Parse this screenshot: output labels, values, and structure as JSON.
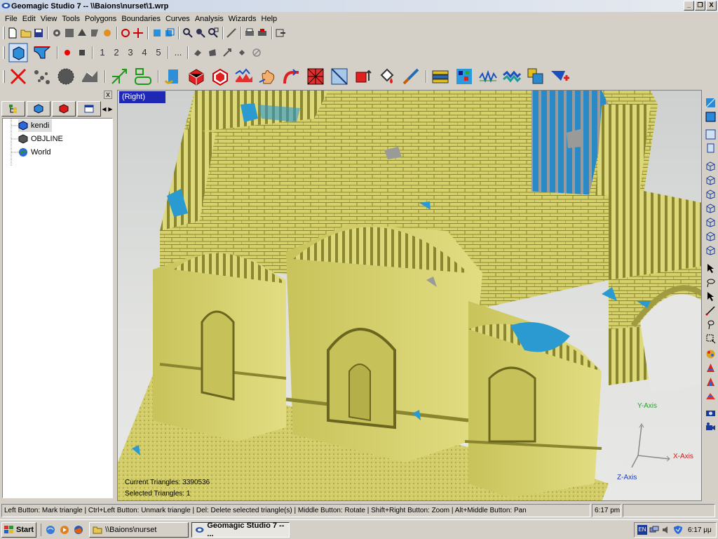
{
  "window": {
    "title": "Geomagic Studio 7 -- \\\\Baions\\nurset\\1.wrp",
    "minimize": "_",
    "restore": "❐",
    "close": "X"
  },
  "menu": [
    "File",
    "Edit",
    "View",
    "Tools",
    "Polygons",
    "Boundaries",
    "Curves",
    "Analysis",
    "Wizards",
    "Help"
  ],
  "macro_toolbar": {
    "record_numbers": [
      "1",
      "2",
      "3",
      "4",
      "5"
    ],
    "more": "..."
  },
  "panel": {
    "close": "x",
    "tree": [
      {
        "label": "kendi",
        "icon": "mesh-object-icon",
        "selected": true
      },
      {
        "label": "OBJLINE",
        "icon": "line-object-icon",
        "selected": false
      },
      {
        "label": "World",
        "icon": "world-globe-icon",
        "selected": false
      }
    ]
  },
  "viewport": {
    "view_name": "(Right)",
    "current_triangles": "Current Triangles: 3390536",
    "selected_triangles": "Selected Triangles: 1",
    "axes": {
      "y": "Y-Axis",
      "x": "X-Axis",
      "z": "Z-Axis"
    },
    "colors": {
      "mesh": "#d8d36a",
      "selected": "#1f94cc",
      "y_axis": "#2e9b2e",
      "x_axis": "#c42020",
      "z_axis": "#1e3cb4"
    }
  },
  "status": {
    "hint": "Left Button: Mark triangle | Ctrl+Left Button: Unmark triangle | Del: Delete selected triangle(s) | Middle Button: Rotate | Shift+Right Button: Zoom | Alt+Middle Button: Pan",
    "time": "6:17 pm",
    "extra": ""
  },
  "taskbar": {
    "start": "Start",
    "tasks": [
      {
        "label": "\\\\Baions\\nurset",
        "active": false
      },
      {
        "label": "Geomagic Studio 7 -- ...",
        "active": true
      }
    ],
    "tray_lang": "EN",
    "clock": "6:17 μμ"
  }
}
